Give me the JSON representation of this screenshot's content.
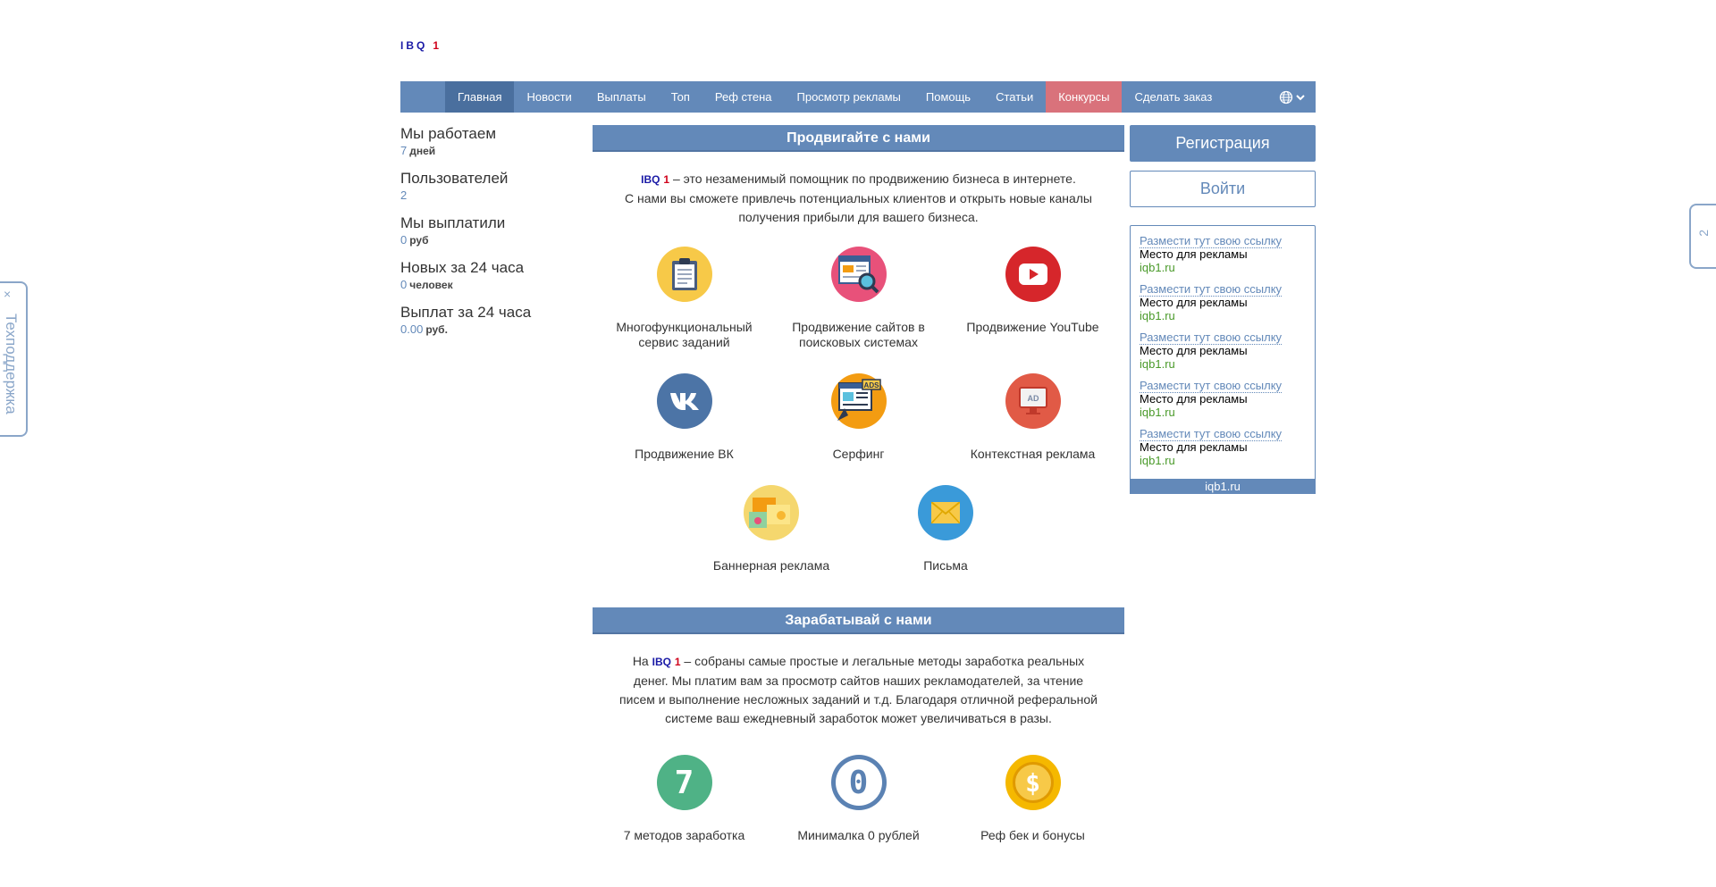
{
  "logo": {
    "letters": "IBQ",
    "number": "1"
  },
  "nav": {
    "items": [
      "Главная",
      "Новости",
      "Выплаты",
      "Топ",
      "Реф стена",
      "Просмотр рекламы",
      "Помощь",
      "Статьи",
      "Конкурсы",
      "Сделать заказ"
    ]
  },
  "stats": [
    {
      "title": "Мы работаем",
      "value": "7",
      "unit": "дней"
    },
    {
      "title": "Пользователей",
      "value": "2",
      "unit": ""
    },
    {
      "title": "Мы выплатили",
      "value": "0",
      "unit": "руб"
    },
    {
      "title": "Новых за 24 часа",
      "value": "0",
      "unit": "человек"
    },
    {
      "title": "Выплат за 24 часа",
      "value": "0.00",
      "unit": "руб."
    }
  ],
  "promote": {
    "heading": "Продвигайте с нами",
    "brand_letters": "IBQ",
    "brand_number": "1",
    "line1": " – это незаменимый помощник по продвижению бизнеса в интернете.",
    "line2": "С нами вы сможете привлечь потенциальных клиентов и открыть новые каналы получения прибыли для вашего бизнеса.",
    "services": [
      {
        "label": "Многофункциональный сервис заданий",
        "icon": "clipboard-icon",
        "color": "#f7c948"
      },
      {
        "label": "Продвижение сайтов в поисковых системах",
        "icon": "seo-search-icon",
        "color": "#e8517a"
      },
      {
        "label": "Продвижение YouTube",
        "icon": "youtube-icon",
        "color": "#d6262b"
      },
      {
        "label": "Продвижение ВК",
        "icon": "vk-icon",
        "color": "#4c74a6"
      },
      {
        "label": "Серфинг",
        "icon": "surfing-ads-icon",
        "color": "#f39c12"
      },
      {
        "label": "Контекстная реклама",
        "icon": "ad-screen-icon",
        "color": "#e15a46"
      },
      {
        "label": "Баннерная реклама",
        "icon": "banner-icon",
        "color": "#f5d76e"
      },
      {
        "label": "Письма",
        "icon": "envelope-icon",
        "color": "#3a9ad9"
      }
    ]
  },
  "earn": {
    "heading": "Зарабатывай с нами",
    "prefix": "На ",
    "brand_letters": "IBQ",
    "brand_number": "1",
    "text": " – собраны самые простые и легальные методы заработка реальных денег. Мы платим вам за просмотр сайтов наших рекламодателей, за чтение писем и выполнение несложных заданий и т.д. Благодаря отличной реферальной системе ваш ежедневный заработок может увеличиваться в разы.",
    "features": [
      {
        "label": "7 методов заработка",
        "symbol": "7",
        "color": "#4fb286"
      },
      {
        "label": "Минималка 0 рублей",
        "symbol": "0",
        "color": "#5b82b3"
      },
      {
        "label": "Реф бек и бонусы",
        "symbol": "$",
        "color": "#f5b800"
      }
    ]
  },
  "side": {
    "register": "Регистрация",
    "login": "Войти",
    "ads": [
      {
        "link": "Размести тут свою ссылку",
        "desc": "Место для рекламы",
        "site": "iqb1.ru"
      },
      {
        "link": "Размести тут свою ссылку",
        "desc": "Место для рекламы",
        "site": "iqb1.ru"
      },
      {
        "link": "Размести тут свою ссылку",
        "desc": "Место для рекламы",
        "site": "iqb1.ru"
      },
      {
        "link": "Размести тут свою ссылку",
        "desc": "Место для рекламы",
        "site": "iqb1.ru"
      },
      {
        "link": "Размести тут свою ссылку",
        "desc": "Место для рекламы",
        "site": "iqb1.ru"
      }
    ],
    "ads_footer": "iqb1.ru"
  },
  "support": {
    "close": "×",
    "label": "Техподдержка"
  },
  "right_tab": {
    "number": "2"
  }
}
